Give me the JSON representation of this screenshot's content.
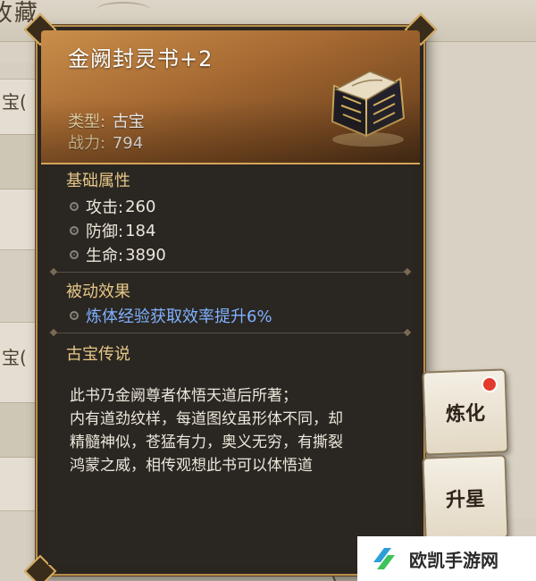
{
  "background": {
    "title": "收藏",
    "card_label_1": "宝(",
    "card_label_2": "宝("
  },
  "item": {
    "name": "金阙封灵书+2",
    "type_label": "类型:",
    "type_value": "古宝",
    "power_label": "战力:",
    "power_value": "794"
  },
  "base_attributes": {
    "title": "基础属性",
    "stats": [
      {
        "label": "攻击:",
        "value": "260"
      },
      {
        "label": "防御:",
        "value": "184"
      },
      {
        "label": "生命:",
        "value": "3890"
      }
    ]
  },
  "passive": {
    "title": "被动效果",
    "effect": "炼体经验获取效率提升6%"
  },
  "lore": {
    "title": "古宝传说",
    "lines": [
      "此书乃金阙尊者体悟天道后所著；",
      "内有道劲纹样，每道图纹虽形体不同，却",
      "精髓神似，苍猛有力，奥义无穷，有撕裂",
      "鸿蒙之威，相传观想此书可以体悟道"
    ]
  },
  "buttons": {
    "refine": "炼化",
    "star_up": "升星"
  },
  "watermark": {
    "text": "欧凯手游网"
  },
  "colors": {
    "accent_gold": "#e7c787",
    "passive_blue": "#7fb2ff",
    "notify_red": "#e23b2e"
  }
}
